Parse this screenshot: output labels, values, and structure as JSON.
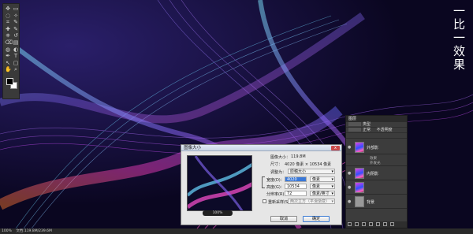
{
  "side_title": "一比一效果",
  "toolbar": {
    "tools": [
      "move-icon",
      "marquee-icon",
      "lasso-icon",
      "magic-wand-icon",
      "crop-icon",
      "eyedropper-icon",
      "healing-icon",
      "brush-icon",
      "stamp-icon",
      "history-brush-icon",
      "eraser-icon",
      "gradient-icon",
      "blur-icon",
      "dodge-icon",
      "pen-icon",
      "type-icon",
      "path-select-icon",
      "shape-icon",
      "hand-icon",
      "zoom-icon"
    ],
    "foreground_color": "#000000",
    "background_color": "#ffffff"
  },
  "layers_panel": {
    "title": "图层",
    "row1": "类型",
    "row2": "正常",
    "opacity_label": "不透明度",
    "layers": [
      {
        "name": "外部影",
        "sub": [
          "效果",
          "外发光"
        ]
      },
      {
        "name": "内阴影",
        "sub": []
      },
      {
        "name": "背景",
        "sub": []
      }
    ]
  },
  "dialog": {
    "title": "图像大小",
    "close": "x",
    "image_size_label": "图像大小：",
    "image_size_value": "119.8M",
    "dimensions_label": "尺寸：",
    "dimensions_value": "4020 像素 × 10534 像素",
    "fit_label": "调整为：",
    "fit_value": "原稿大小",
    "width_label": "宽度(D)：",
    "width_value": "4020",
    "width_unit": "像素",
    "height_label": "高度(G)：",
    "height_value": "10534",
    "height_unit": "像素",
    "resolution_label": "分辨率(R)：",
    "resolution_value": "72",
    "resolution_unit": "像素/英寸",
    "resample_label": "重新采样(S)：",
    "resample_value": "两次立方（平滑渐变）",
    "zoom": "100%",
    "cancel_label": "取消",
    "ok_label": "确定"
  },
  "status": {
    "zoom": "100%",
    "doc": "文档:119.8M/239.6M"
  }
}
